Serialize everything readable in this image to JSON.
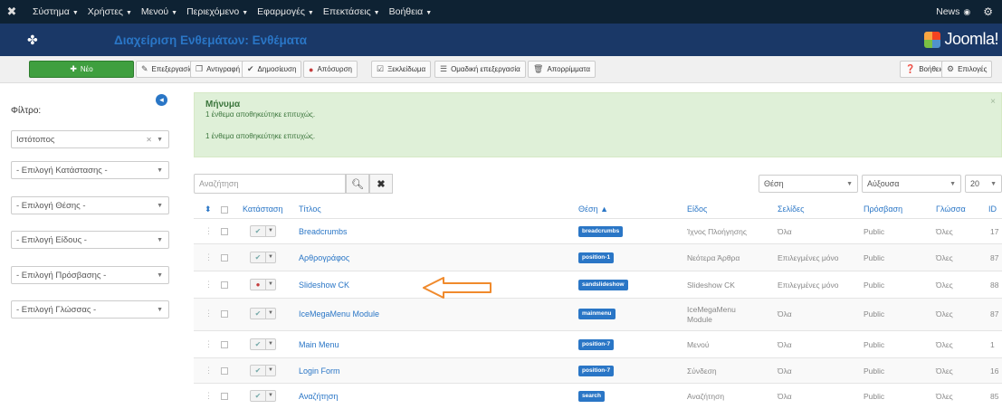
{
  "topnav": {
    "items": [
      "Σύστημα",
      "Χρήστες",
      "Μενού",
      "Περιεχόμενο",
      "Εφαρμογές",
      "Επεκτάσεις",
      "Βοήθεια"
    ],
    "right": "News"
  },
  "header": {
    "title": "Διαχείριση Ενθεμάτων: Ενθέματα",
    "brand": "Joomla!"
  },
  "toolbar": {
    "new": "Νέο",
    "edit": "Επεξεργασία",
    "copy": "Αντιγραφή",
    "publish": "Δημοσίευση",
    "unpublish": "Απόσυρση",
    "checkin": "Ξεκλείδωμα",
    "batch": "Ομαδική επεξεργασία",
    "trash": "Απορρίμματα",
    "help": "Βοήθεια",
    "options": "Επιλογές"
  },
  "sidebar": {
    "filter_label": "Φίλτρο:",
    "filters": [
      "Ιστότοπος",
      "- Επιλογή Κατάστασης -",
      "- Επιλογή Θέσης -",
      "- Επιλογή Είδους -",
      "- Επιλογή Πρόσβασης -",
      "- Επιλογή Γλώσσας -"
    ]
  },
  "message": {
    "title": "Μήνυμα",
    "line1": "1 ένθεμα αποθηκεύτηκε επιτυχώς.",
    "line2": "1 ένθεμα αποθηκεύτηκε επιτυχώς."
  },
  "search": {
    "placeholder": "Αναζήτηση",
    "search_icon": "search-icon",
    "clear_icon": "clear-icon"
  },
  "controls": {
    "sort": "Θέση",
    "order": "Αύξουσα",
    "limit": "20"
  },
  "table": {
    "headers": [
      "Κατάσταση",
      "Τίτλος",
      "Θέση",
      "Είδος",
      "Σελίδες",
      "Πρόσβαση",
      "Γλώσσα",
      "ID"
    ],
    "rows": [
      {
        "title": "Breadcrumbs",
        "position": "breadcrumbs",
        "type": "Ίχνος Πλοήγησης",
        "pages": "Όλα",
        "access": "Public",
        "lang": "Όλες",
        "id": "17",
        "state": "on"
      },
      {
        "title": "Αρθρογράφος",
        "position": "position-1",
        "type": "Νεότερα Άρθρα",
        "pages": "Επιλεγμένες μόνο",
        "access": "Public",
        "lang": "Όλες",
        "id": "87",
        "state": "on"
      },
      {
        "title": "Slideshow CK",
        "position": "sandslideshow",
        "type": "Slideshow CK",
        "pages": "Επιλεγμένες μόνο",
        "access": "Public",
        "lang": "Όλες",
        "id": "88",
        "state": "off"
      },
      {
        "title": "IceMegaMenu Module",
        "position": "mainmenu",
        "type": "IceMegaMenu Module",
        "pages": "Όλα",
        "access": "Public",
        "lang": "Όλες",
        "id": "87",
        "state": "on"
      },
      {
        "title": "Main Menu",
        "position": "position-7",
        "type": "Μενού",
        "pages": "Όλα",
        "access": "Public",
        "lang": "Όλες",
        "id": "1",
        "state": "on"
      },
      {
        "title": "Login Form",
        "position": "position-7",
        "type": "Σύνδεση",
        "pages": "Όλα",
        "access": "Public",
        "lang": "Όλες",
        "id": "16",
        "state": "on"
      },
      {
        "title": "Αναζήτηση",
        "position": "search",
        "type": "Αναζήτηση",
        "pages": "Όλα",
        "access": "Public",
        "lang": "Όλες",
        "id": "85",
        "state": "on"
      }
    ]
  }
}
